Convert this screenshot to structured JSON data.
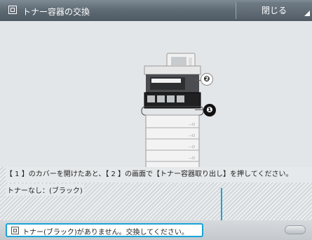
{
  "window": {
    "title": "トナー容器の交換",
    "title_icon": "screen-icon",
    "close_label": "閉じる"
  },
  "illustration": {
    "callout_1": "❶",
    "callout_2": "❷"
  },
  "messages": {
    "instruction": "【 1 】のカバーを開けたあと、【 2 】の画面で【トナー容器取り出し】を押してください。",
    "status": "トナーなし：(ブラック)"
  },
  "statusbar": {
    "message": "トナー(ブラック)がありません。交換してください。",
    "icon": "screen-icon"
  },
  "colors": {
    "accent": "#1aa3d9",
    "titlebar": "#5f6b75"
  }
}
